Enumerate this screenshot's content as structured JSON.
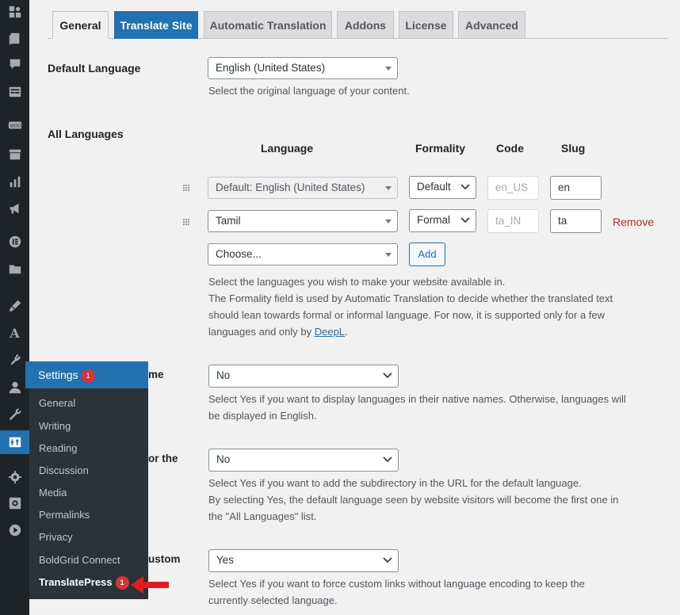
{
  "tabs": [
    {
      "label": "General"
    },
    {
      "label": "Translate Site"
    },
    {
      "label": "Automatic Translation"
    },
    {
      "label": "Addons"
    },
    {
      "label": "License"
    },
    {
      "label": "Advanced"
    }
  ],
  "default_language": {
    "label": "Default Language",
    "value": "English (United States)",
    "description": "Select the original language of your content."
  },
  "all_languages": {
    "label": "All Languages",
    "columns": {
      "language": "Language",
      "formality": "Formality",
      "code": "Code",
      "slug": "Slug"
    },
    "rows": [
      {
        "language": "Default: English (United States)",
        "formality": "Default",
        "code": "en_US",
        "slug": "en"
      },
      {
        "language": "Tamil",
        "formality": "Formal",
        "code": "ta_IN",
        "slug": "ta",
        "remove": "Remove"
      }
    ],
    "choose_placeholder": "Choose...",
    "add_label": "Add",
    "desc_line1": "Select the languages you wish to make your website available in.",
    "desc_line2": "The Formality field is used by Automatic Translation to decide whether the translated text",
    "desc_line3": "should lean towards formal or informal language. For now, it is supported only for a few",
    "desc_line4_pre": "languages and only by ",
    "desc_link": "DeepL",
    "desc_line4_post": "."
  },
  "native_names": {
    "label_fragment": "me",
    "value": "No",
    "desc_line1": "Select Yes if you want to display languages in their native names. Otherwise, languages will",
    "desc_line2": "be displayed in English."
  },
  "subdirectory": {
    "label_fragment": "or the",
    "value": "No",
    "desc_line1": "Select Yes if you want to add the subdirectory in the URL for the default language.",
    "desc_line2": "By selecting Yes, the default language seen by website visitors will become the first one in",
    "desc_line3": "the \"All Languages\" list."
  },
  "force_links": {
    "label_fragment": "ustom",
    "value": "Yes",
    "desc_line1": "Select Yes if you want to force custom links without language encoding to keep the",
    "desc_line2": "currently selected language."
  },
  "flyout": {
    "title": "Settings",
    "title_badge": "1",
    "items": [
      {
        "label": "General"
      },
      {
        "label": "Writing"
      },
      {
        "label": "Reading"
      },
      {
        "label": "Discussion"
      },
      {
        "label": "Media"
      },
      {
        "label": "Permalinks"
      },
      {
        "label": "Privacy"
      },
      {
        "label": "BoldGrid Connect"
      },
      {
        "label": "TranslatePress",
        "badge": "1"
      }
    ]
  },
  "sidebar_icons": [
    "dashboard-icon",
    "pages-icon",
    "comments-icon",
    "forms-icon",
    "woocommerce-icon",
    "products-icon",
    "analytics-icon",
    "marketing-icon",
    "elementor-icon",
    "templates-icon",
    "appearance-icon",
    "astra-icon",
    "plugins-icon",
    "users-icon",
    "tools-icon",
    "settings-icon",
    "gear-icon",
    "record-icon",
    "play-icon"
  ],
  "colors": {
    "accent": "#2271b1",
    "sidebar": "#1d2327",
    "badge": "#d63638",
    "arrow": "#e31b1b"
  }
}
